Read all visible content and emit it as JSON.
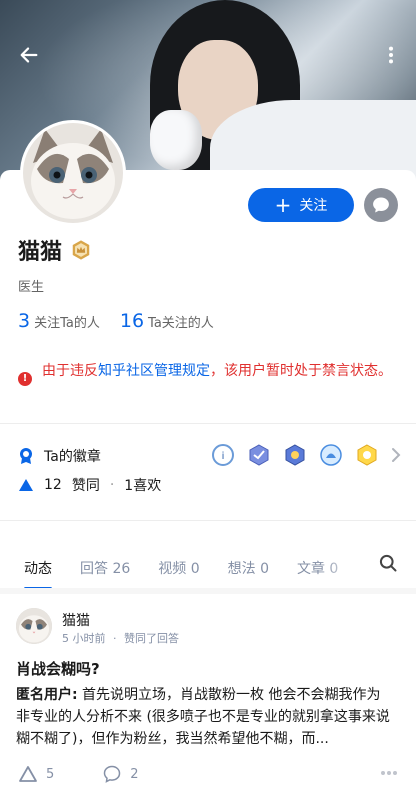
{
  "status_bar": {
    "text": ""
  },
  "icons": {
    "back": "arrow-left-icon",
    "more": "more-vertical-icon",
    "message": "message-bubble-icon",
    "level_badge": "crown-badge-icon",
    "warning": "warning-icon",
    "badge_medal": "medal-icon",
    "likes": "triangle-up-icon",
    "search": "search-icon"
  },
  "colors": {
    "accent": "#0a66e6",
    "warning": "#e0302f",
    "muted": "#8590a6"
  },
  "header": {
    "follow_label": "关注",
    "follow_plus": "+"
  },
  "profile": {
    "name": "猫猫",
    "occupation": "医生",
    "following_count": "3",
    "following_label": "关注Ta的人",
    "followers_count": "16",
    "followers_label": "Ta关注的人"
  },
  "notice": {
    "prefix": "由于违反",
    "link": "知乎社区管理规定",
    "suffix": "，该用户暂时处于禁言状态。"
  },
  "badges": {
    "label": "Ta的徽章"
  },
  "likes": {
    "count": "12",
    "label": "赞同",
    "sep": "·",
    "fav": "1喜欢"
  },
  "tabs": [
    {
      "label": "动态"
    },
    {
      "label": "回答 26"
    },
    {
      "label": "视频 0"
    },
    {
      "label": "想法 0"
    },
    {
      "label": "文章 0"
    }
  ],
  "feed": {
    "author": "猫猫",
    "time": "5 小时前",
    "meta_sep": "·",
    "action": "赞同了回答",
    "title": "肖战会糊吗?",
    "excerpt_author": "匿名用户:",
    "excerpt": " 首先说明立场，肖战散粉一枚 他会不会糊我作为非专业的人分析不来 (很多喷子也不是专业的就别拿这事来说糊不糊了)，但作为粉丝，我当然希望他不糊，而...",
    "upvotes": "5",
    "comments": "2"
  }
}
